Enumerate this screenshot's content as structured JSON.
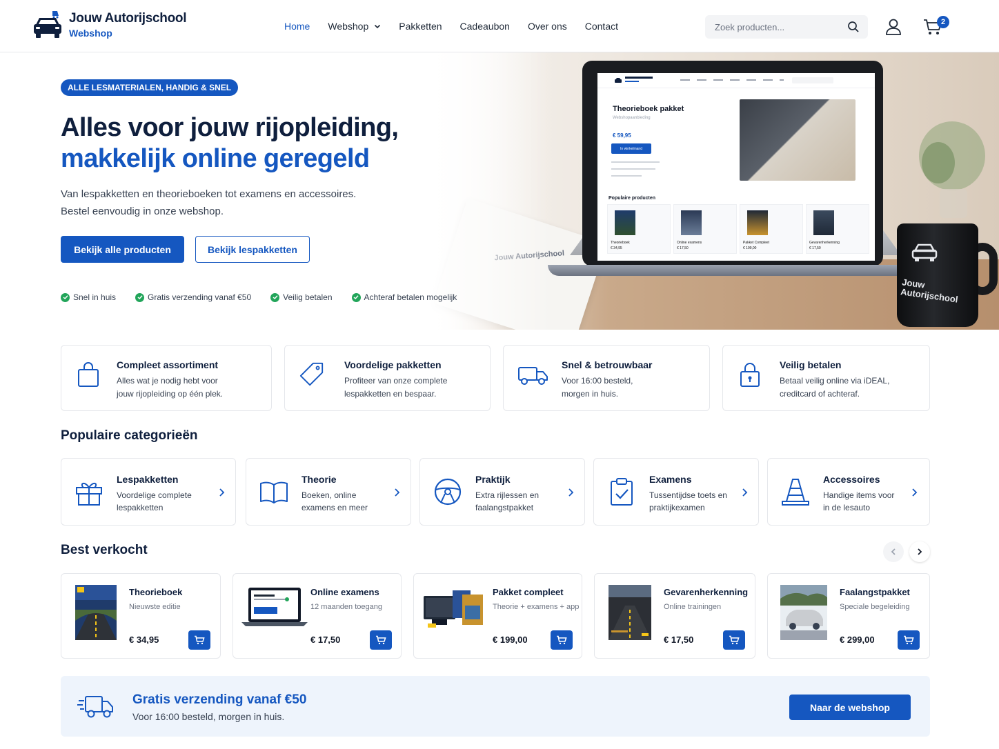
{
  "header": {
    "logo_title": "Jouw Autorijschool",
    "logo_sub": "Webshop",
    "nav": [
      {
        "label": "Home"
      },
      {
        "label": "Webshop"
      },
      {
        "label": "Pakketten"
      },
      {
        "label": "Cadeaubon"
      },
      {
        "label": "Over ons"
      },
      {
        "label": "Contact"
      }
    ],
    "search_placeholder": "Zoek producten...",
    "cart_count": "2"
  },
  "hero": {
    "badge": "ALLE LESMATERIALEN, HANDIG & SNEL",
    "title_line1": "Alles voor jouw rijopleiding,",
    "title_line2": "makkelijk online geregeld",
    "text_line1": "Van lespakketten en theorieboeken tot examens en accessoires.",
    "text_line2": "Bestel eenvoudig in onze webshop.",
    "btn_primary": "Bekijk alle producten",
    "btn_outline": "Bekijk lespakketten",
    "usps": [
      "Snel in huis",
      "Gratis verzending vanaf €50",
      "Veilig betalen",
      "Achteraf betalen mogelijk"
    ],
    "laptop": {
      "title": "Theorieboek pakket",
      "subtitle": "Webshopaanbieding",
      "price": "€ 59,95",
      "button": "In winkelmand",
      "popular": "Populaire producten",
      "cards": [
        {
          "name": "Theorieboek",
          "price": "€ 34,95"
        },
        {
          "name": "Online examens",
          "price": "€ 17,50"
        },
        {
          "name": "Pakket Compleet",
          "price": "€ 199,00"
        },
        {
          "name": "Gevarenherkenning",
          "price": "€ 17,50"
        }
      ]
    },
    "notebook_text": "Jouw Autorijschool",
    "mug_text_1": "Jouw",
    "mug_text_2": "Autorijschool"
  },
  "features": [
    {
      "title": "Compleet assortiment",
      "line1": "Alles wat je nodig hebt voor",
      "line2": "jouw rijopleiding op één plek.",
      "icon": "shopping-bag-icon"
    },
    {
      "title": "Voordelige pakketten",
      "line1": "Profiteer van onze complete",
      "line2": "lespakketten en bespaar.",
      "icon": "price-tag-icon"
    },
    {
      "title": "Snel & betrouwbaar",
      "line1": "Voor 16:00 besteld,",
      "line2": "morgen in huis.",
      "icon": "truck-icon"
    },
    {
      "title": "Veilig betalen",
      "line1": "Betaal veilig online via iDEAL,",
      "line2": "creditcard of achteraf.",
      "icon": "lock-icon"
    }
  ],
  "categories_title": "Populaire categorieën",
  "categories": [
    {
      "title": "Lespakketten",
      "line1": "Voordelige complete",
      "line2": "lespakketten",
      "icon": "gift-icon"
    },
    {
      "title": "Theorie",
      "line1": "Boeken, online",
      "line2": "examens en meer",
      "icon": "book-icon"
    },
    {
      "title": "Praktijk",
      "line1": "Extra rijlessen en",
      "line2": "faalangstpakket",
      "icon": "steering-wheel-icon"
    },
    {
      "title": "Examens",
      "line1": "Tussentijdse toets en",
      "line2": "praktijkexamen",
      "icon": "clipboard-check-icon"
    },
    {
      "title": "Accessoires",
      "line1": "Handige items voor",
      "line2": "in de lesauto",
      "icon": "traffic-cone-icon"
    }
  ],
  "bestsellers_title": "Best verkocht",
  "products": [
    {
      "name": "Theorieboek",
      "sub": "Nieuwste editie",
      "price": "€ 34,95"
    },
    {
      "name": "Online examens",
      "sub": "12 maanden toegang",
      "price": "€ 17,50"
    },
    {
      "name": "Pakket compleet",
      "sub": "Theorie + examens + app",
      "price": "€ 199,00"
    },
    {
      "name": "Gevarenherkenning",
      "sub": "Online trainingen",
      "price": "€ 17,50"
    },
    {
      "name": "Faalangstpakket",
      "sub": "Speciale begeleiding",
      "price": "€ 299,00"
    }
  ],
  "banner": {
    "title": "Gratis verzending vanaf €50",
    "sub": "Voor 16:00 besteld, morgen in huis.",
    "button": "Naar de webshop"
  },
  "colors": {
    "primary": "#1557c0",
    "navy": "#0f1f3d",
    "success": "#22a55a",
    "banner_bg": "#eef4fc"
  }
}
